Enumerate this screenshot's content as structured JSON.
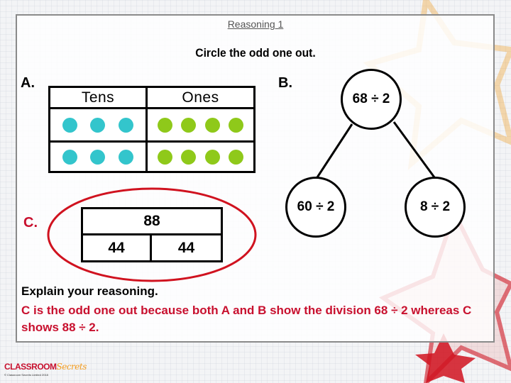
{
  "header": {
    "title": "Reasoning 1",
    "instruction": "Circle the odd one out."
  },
  "colors": {
    "tens_dot": "#33c5cc",
    "ones_dot": "#8fc91a",
    "answer_red": "#c8102e",
    "circle_highlight": "#d0121f"
  },
  "option_a": {
    "label": "A.",
    "columns": [
      "Tens",
      "Ones"
    ],
    "rows": [
      {
        "tens": 3,
        "ones": 4
      },
      {
        "tens": 3,
        "ones": 4
      }
    ]
  },
  "option_b": {
    "label": "B.",
    "root": "68 ÷ 2",
    "left": "60 ÷ 2",
    "right": "8 ÷ 2"
  },
  "option_c": {
    "label": "C.",
    "whole": "88",
    "parts": [
      "44",
      "44"
    ],
    "circled": true
  },
  "explanation": {
    "prompt": "Explain your reasoning.",
    "answer": "C is the odd one out because both A and B show the division 68 ÷ 2 whereas C shows 88 ÷ 2."
  },
  "footer": {
    "logo_primary": "CLASSROOM",
    "logo_secondary": "Secrets",
    "copyright": "© Classroom Secrets Limited 2018"
  }
}
